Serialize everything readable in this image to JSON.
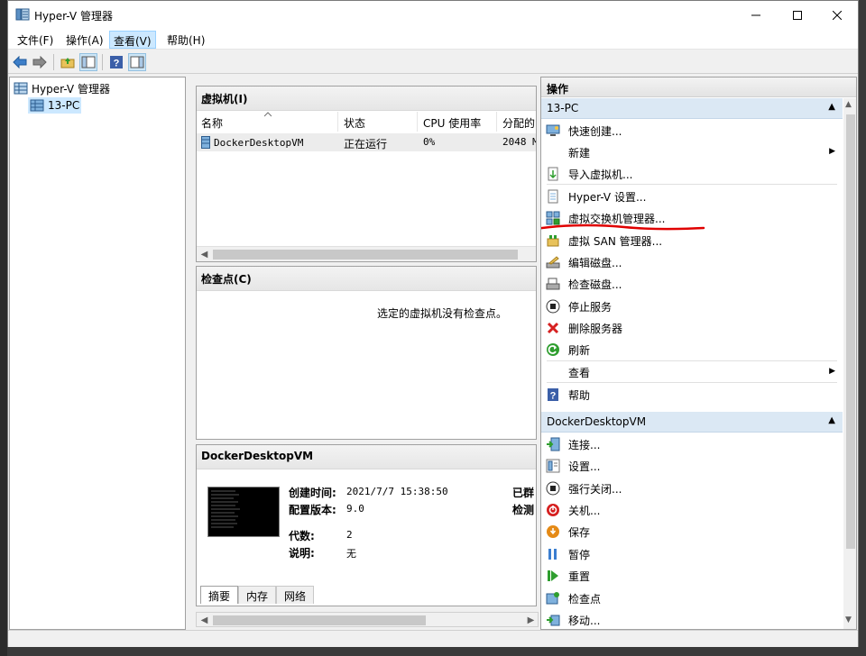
{
  "window": {
    "title": "Hyper-V 管理器"
  },
  "menu": [
    "文件(F)",
    "操作(A)",
    "查看(V)",
    "帮助(H)"
  ],
  "tree": {
    "root": "Hyper-V 管理器",
    "server": "13-PC"
  },
  "vm_panel": {
    "title": "虚拟机(I)",
    "columns": [
      "名称",
      "状态",
      "CPU 使用率",
      "分配的"
    ],
    "rows": [
      {
        "name": "DockerDesktopVM",
        "status": "正在运行",
        "cpu": "0%",
        "memory": "2048 M"
      }
    ]
  },
  "checkpoint_panel": {
    "title": "检查点(C)",
    "empty_text": "选定的虚拟机没有检查点。"
  },
  "detail_panel": {
    "title": "DockerDesktopVM",
    "fields": {
      "created_label": "创建时间:",
      "created_value": "2021/7/7 15:38:50",
      "config_label": "配置版本:",
      "config_value": "9.0",
      "gen_label": "代数:",
      "gen_value": "2",
      "notes_label": "说明:",
      "notes_value": "无",
      "clustered_label": "已群",
      "heartbeat_label": "检测"
    },
    "tabs": [
      "摘要",
      "内存",
      "网络"
    ]
  },
  "actions": {
    "title": "操作",
    "group1": {
      "title": "13-PC",
      "items": [
        "快速创建...",
        "新建",
        "导入虚拟机...",
        "Hyper-V 设置...",
        "虚拟交换机管理器...",
        "虚拟 SAN 管理器...",
        "编辑磁盘...",
        "检查磁盘...",
        "停止服务",
        "删除服务器",
        "刷新",
        "查看",
        "帮助"
      ]
    },
    "group2": {
      "title": "DockerDesktopVM",
      "items": [
        "连接...",
        "设置...",
        "强行关闭...",
        "关机...",
        "保存",
        "暂停",
        "重置",
        "检查点",
        "移动..."
      ]
    }
  },
  "colors": {
    "highlight_underline": "#e00000",
    "group_header": "#dbe8f4"
  }
}
